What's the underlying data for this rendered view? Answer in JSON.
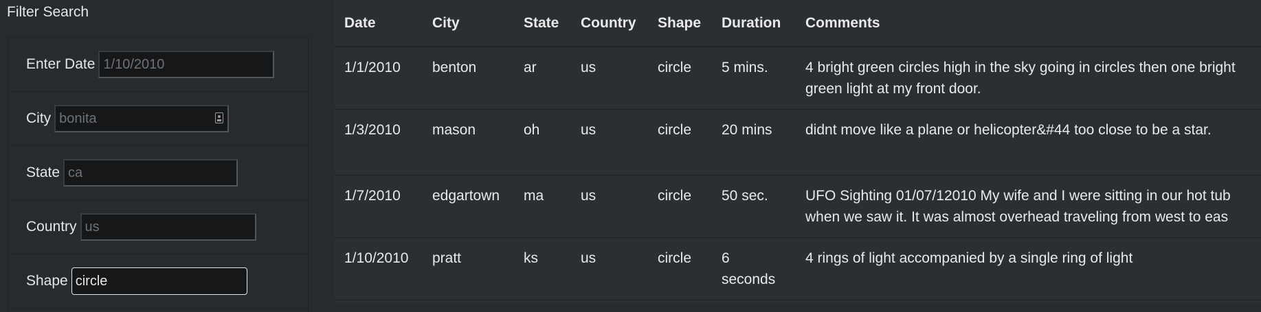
{
  "filter": {
    "title": "Filter Search",
    "fields": [
      {
        "label": "Enter Date",
        "placeholder": "1/10/2010",
        "value": ""
      },
      {
        "label": "City",
        "placeholder": "bonita",
        "value": ""
      },
      {
        "label": "State",
        "placeholder": "ca",
        "value": ""
      },
      {
        "label": "Country",
        "placeholder": "us",
        "value": ""
      },
      {
        "label": "Shape",
        "placeholder": "",
        "value": "circle"
      }
    ]
  },
  "table": {
    "headers": [
      "Date",
      "City",
      "State",
      "Country",
      "Shape",
      "Duration",
      "Comments"
    ],
    "rows": [
      [
        "1/1/2010",
        "benton",
        "ar",
        "us",
        "circle",
        "5 mins.",
        "4 bright green circles high in the sky going in circles then one bright green light at my front door."
      ],
      [
        "1/3/2010",
        "mason",
        "oh",
        "us",
        "circle",
        "20 mins",
        "didnt move like a plane or helicopter&#44 too close to be a star."
      ],
      [
        "1/7/2010",
        "edgartown",
        "ma",
        "us",
        "circle",
        "50 sec.",
        "UFO Sighting 01/07/12010 My wife and I were sitting in our hot tub when we saw it. It was almost overhead traveling from west to eas"
      ],
      [
        "1/10/2010",
        "pratt",
        "ks",
        "us",
        "circle",
        "6 seconds",
        "4 rings of light accompanied by a single ring of light"
      ]
    ]
  },
  "icons": {
    "city_field_icon": "contact-card-icon"
  }
}
